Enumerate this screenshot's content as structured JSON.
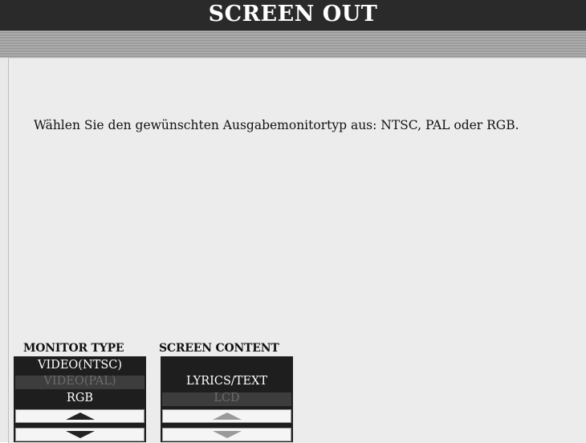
{
  "header": {
    "title": "SCREEN OUT"
  },
  "message": "Wählen Sie den gewünschten Ausgabemonitortyp aus: NTSC, PAL oder RGB.",
  "monitor_type": {
    "label": "MONITOR TYPE",
    "options": [
      "VIDEO(NTSC)",
      "VIDEO(PAL)",
      "RGB"
    ],
    "selected": "VIDEO(PAL)"
  },
  "screen_content": {
    "label": "SCREEN CONTENT",
    "options": [
      "LYRICS/TEXT",
      "LCD"
    ],
    "selected": "LCD"
  },
  "icons": {
    "up": "up-arrow-icon",
    "down": "down-arrow-icon"
  }
}
